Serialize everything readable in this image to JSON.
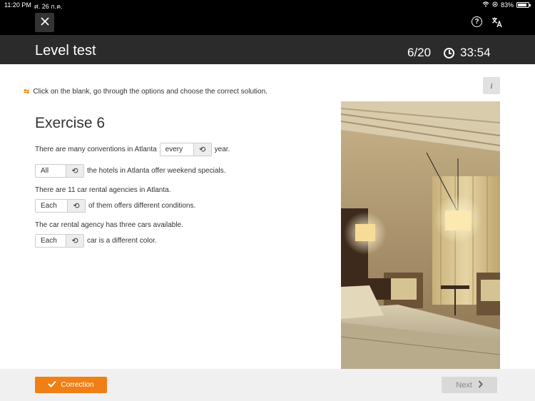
{
  "status_bar": {
    "time": "11:20 PM",
    "date": "ศ. 26 ก.ค.",
    "battery": "83%",
    "battery_level": 0.83
  },
  "top_nav": {
    "close_icon": "close-icon",
    "help_icon": "question-circle-icon",
    "help_glyph": "?",
    "translate_icon": "translate-icon"
  },
  "header": {
    "title": "Level test",
    "progress": "6/20",
    "timer": "33:54"
  },
  "instruction": {
    "icon": "swap-arrows-icon",
    "icon_glyph": "⇆",
    "text": "Click on the blank, go through the options and choose the correct solution."
  },
  "info_button": {
    "glyph": "i"
  },
  "exercise": {
    "title": "Exercise 6",
    "lines": [
      {
        "before": "There are many conventions in Atlanta",
        "blank": "every",
        "after": "year."
      },
      {
        "before": "",
        "blank": "All",
        "after": "the hotels in Atlanta offer weekend specials."
      },
      {
        "text": "There are 11 car rental agencies in Atlanta."
      },
      {
        "before": "",
        "blank": "Each",
        "after": "of them offers different conditions."
      },
      {
        "text": "The car rental agency has three cars available."
      },
      {
        "before": "",
        "blank": "Each",
        "after": "car is a different color."
      }
    ]
  },
  "footer": {
    "correction_label": "Correction",
    "next_label": "Next"
  },
  "colors": {
    "accent": "#f07f16",
    "header_bg": "#2b2b2b",
    "nav_bg": "#000000",
    "footer_bg": "#f0f0f0"
  }
}
